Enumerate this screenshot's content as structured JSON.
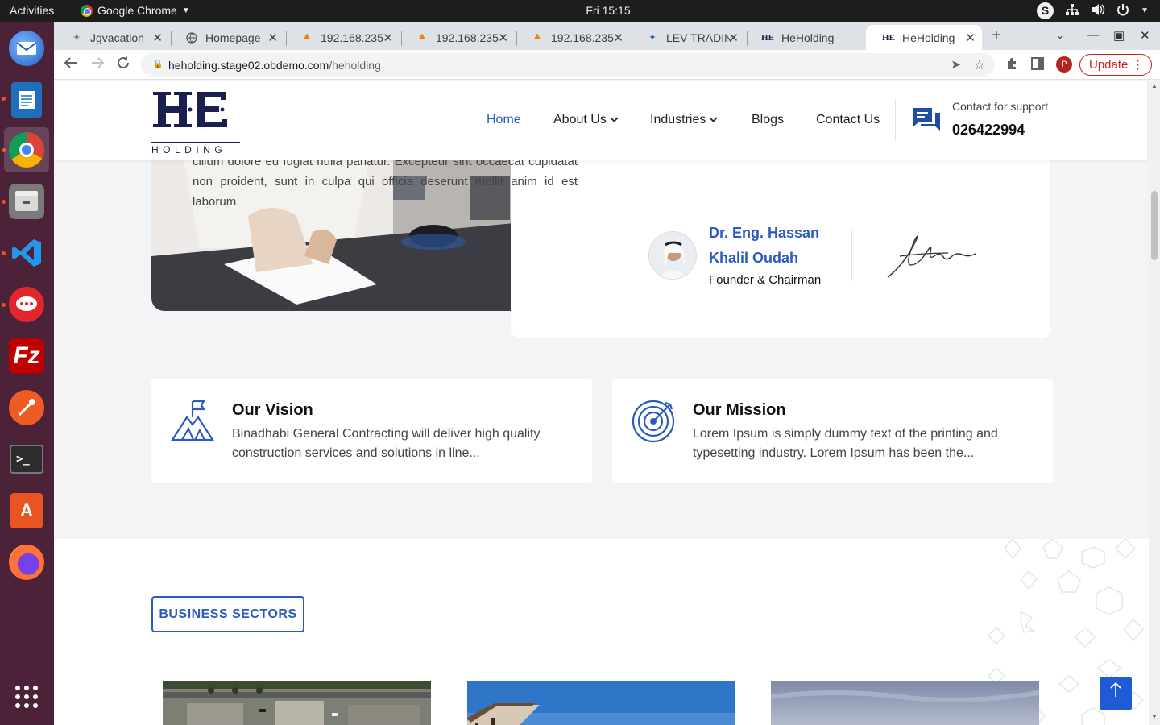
{
  "os": {
    "activities": "Activities",
    "app_name": "Google Chrome",
    "clock": "Fri 15:15"
  },
  "dock": {
    "apps": [
      "thunderbird",
      "libreoffice-writer",
      "google-chrome",
      "files",
      "vscode",
      "rocketchat",
      "filezilla",
      "postman",
      "terminal",
      "app-center",
      "firefox",
      "show-apps"
    ]
  },
  "browser": {
    "tabs": [
      {
        "title": "Jgvacation",
        "active": false
      },
      {
        "title": "Homepage",
        "active": false
      },
      {
        "title": "192.168.235",
        "active": false
      },
      {
        "title": "192.168.235",
        "active": false
      },
      {
        "title": "192.168.235",
        "active": false
      },
      {
        "title": "LEV TRADIN",
        "active": false
      },
      {
        "title": "HeHolding",
        "active": false
      },
      {
        "title": "HeHolding",
        "active": true
      }
    ],
    "url_host": "heholding.stage02.obdemo.com",
    "url_path": "/heholding",
    "profile_initial": "P",
    "update_label": "Update"
  },
  "site": {
    "logo_mark": "HE",
    "logo_word": "HOLDING",
    "nav": [
      {
        "label": "Home",
        "active": true,
        "dropdown": false
      },
      {
        "label": "About Us",
        "active": false,
        "dropdown": true
      },
      {
        "label": "Industries",
        "active": false,
        "dropdown": true
      },
      {
        "label": "Blogs",
        "active": false,
        "dropdown": false
      },
      {
        "label": "Contact Us",
        "active": false,
        "dropdown": false
      }
    ],
    "support_label": "Contact for support",
    "support_number": "026422994",
    "accent": "#2a5bbd"
  },
  "founder": {
    "quote": "cillum dolore eu fugiat nulla pariatur. Excepteur sint occaecat cupidatat non proident, sunt in culpa qui officia deserunt mollit anim id est laborum.",
    "name": "Dr. Eng. Hassan Khalil Oudah",
    "title": "Founder & Chairman"
  },
  "vision": {
    "title": "Our Vision",
    "text": "Binadhabi General Contracting will deliver high quality construction services and solutions in line..."
  },
  "mission": {
    "title": "Our Mission",
    "text": "Lorem Ipsum is simply dummy text of the printing and typesetting industry. Lorem Ipsum has been the..."
  },
  "sectors": {
    "badge": "BUSINESS SECTORS"
  }
}
